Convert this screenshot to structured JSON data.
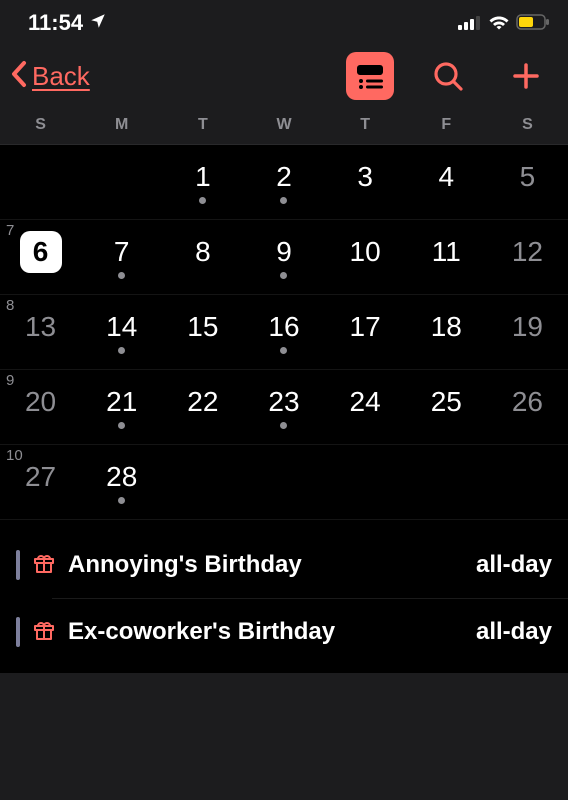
{
  "statusBar": {
    "time": "11:54",
    "locationIcon": "location-arrow",
    "cellular": "3-bars",
    "wifi": "wifi",
    "battery": "low-power"
  },
  "nav": {
    "backLabel": "Back"
  },
  "colors": {
    "accent": "#ff6961",
    "background": "#1c1c1e",
    "gridBg": "#000000",
    "dim": "#8e8e93",
    "eventBar": "#7d7f9c",
    "battery": "#ffd60a"
  },
  "weekdays": [
    "S",
    "M",
    "T",
    "W",
    "T",
    "F",
    "S"
  ],
  "weeks": [
    {
      "num": "",
      "days": [
        {
          "n": "",
          "dim": false,
          "today": false,
          "dot": false
        },
        {
          "n": "",
          "dim": false,
          "today": false,
          "dot": false
        },
        {
          "n": "1",
          "dim": false,
          "today": false,
          "dot": true
        },
        {
          "n": "2",
          "dim": false,
          "today": false,
          "dot": true
        },
        {
          "n": "3",
          "dim": false,
          "today": false,
          "dot": false
        },
        {
          "n": "4",
          "dim": false,
          "today": false,
          "dot": false
        },
        {
          "n": "5",
          "dim": true,
          "today": false,
          "dot": false
        }
      ]
    },
    {
      "num": "7",
      "days": [
        {
          "n": "6",
          "dim": false,
          "today": true,
          "dot": false
        },
        {
          "n": "7",
          "dim": false,
          "today": false,
          "dot": true
        },
        {
          "n": "8",
          "dim": false,
          "today": false,
          "dot": false
        },
        {
          "n": "9",
          "dim": false,
          "today": false,
          "dot": true
        },
        {
          "n": "10",
          "dim": false,
          "today": false,
          "dot": false
        },
        {
          "n": "11",
          "dim": false,
          "today": false,
          "dot": false
        },
        {
          "n": "12",
          "dim": true,
          "today": false,
          "dot": false
        }
      ]
    },
    {
      "num": "8",
      "days": [
        {
          "n": "13",
          "dim": true,
          "today": false,
          "dot": false
        },
        {
          "n": "14",
          "dim": false,
          "today": false,
          "dot": true
        },
        {
          "n": "15",
          "dim": false,
          "today": false,
          "dot": false
        },
        {
          "n": "16",
          "dim": false,
          "today": false,
          "dot": true
        },
        {
          "n": "17",
          "dim": false,
          "today": false,
          "dot": false
        },
        {
          "n": "18",
          "dim": false,
          "today": false,
          "dot": false
        },
        {
          "n": "19",
          "dim": true,
          "today": false,
          "dot": false
        }
      ]
    },
    {
      "num": "9",
      "days": [
        {
          "n": "20",
          "dim": true,
          "today": false,
          "dot": false
        },
        {
          "n": "21",
          "dim": false,
          "today": false,
          "dot": true
        },
        {
          "n": "22",
          "dim": false,
          "today": false,
          "dot": false
        },
        {
          "n": "23",
          "dim": false,
          "today": false,
          "dot": true
        },
        {
          "n": "24",
          "dim": false,
          "today": false,
          "dot": false
        },
        {
          "n": "25",
          "dim": false,
          "today": false,
          "dot": false
        },
        {
          "n": "26",
          "dim": true,
          "today": false,
          "dot": false
        }
      ]
    },
    {
      "num": "10",
      "days": [
        {
          "n": "27",
          "dim": true,
          "today": false,
          "dot": false
        },
        {
          "n": "28",
          "dim": false,
          "today": false,
          "dot": true
        },
        {
          "n": "",
          "dim": false,
          "today": false,
          "dot": false
        },
        {
          "n": "",
          "dim": false,
          "today": false,
          "dot": false
        },
        {
          "n": "",
          "dim": false,
          "today": false,
          "dot": false
        },
        {
          "n": "",
          "dim": false,
          "today": false,
          "dot": false
        },
        {
          "n": "",
          "dim": false,
          "today": false,
          "dot": false
        }
      ]
    }
  ],
  "events": [
    {
      "icon": "gift",
      "title": "Annoying's Birthday",
      "time": "all-day"
    },
    {
      "icon": "gift",
      "title": "Ex-coworker's Birthday",
      "time": "all-day"
    }
  ]
}
